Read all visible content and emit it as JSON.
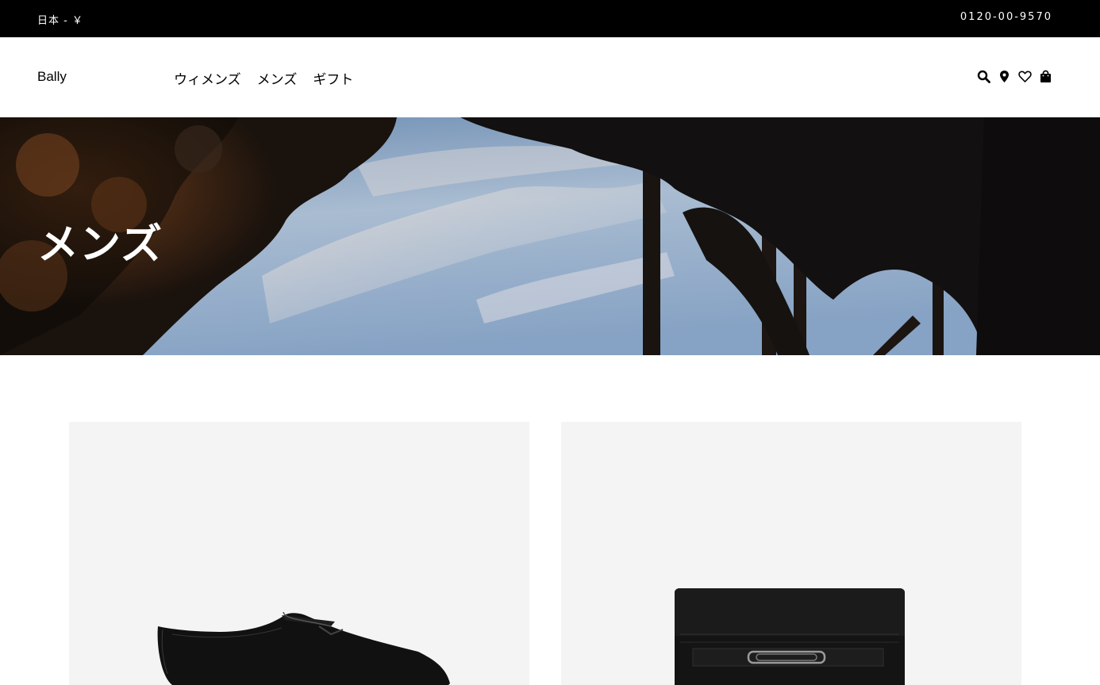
{
  "topbar": {
    "locale": "日本 - ￥",
    "phone": "0120-00-9570"
  },
  "header": {
    "logo": "Bally",
    "nav": [
      {
        "label": "ウィメンズ"
      },
      {
        "label": "メンズ"
      },
      {
        "label": "ギフト"
      }
    ],
    "icons": [
      "search-icon",
      "location-icon",
      "heart-icon",
      "bag-icon"
    ]
  },
  "hero": {
    "title": "メンズ"
  },
  "products": [
    {
      "image": "black-leather-loafer"
    },
    {
      "image": "black-leather-clutch"
    }
  ],
  "colors": {
    "topbar_bg": "#000000",
    "card_bg": "#f4f4f4"
  }
}
